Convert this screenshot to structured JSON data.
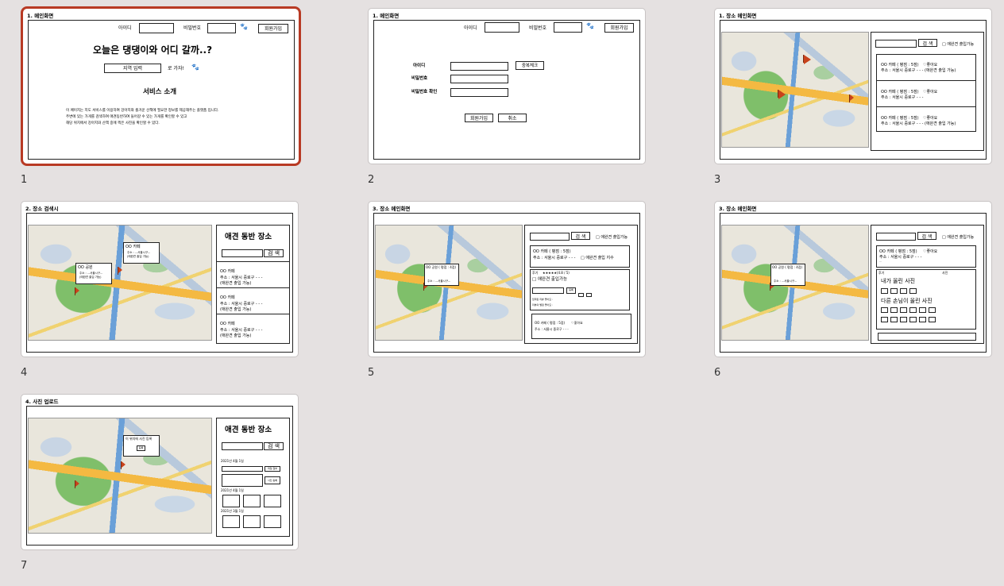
{
  "slides": [
    {
      "num": "1",
      "title": "1. 메인화면",
      "id_label": "아이디",
      "pw_label": "비밀번호",
      "signup": "회원가입",
      "headline": "오늘은 댕댕이와 어디 갈까..?",
      "region_input": "지역 입력",
      "go_label": "로 가자!",
      "about_title": "서비스 소개",
      "about_lines": [
        "이 페이지는 지도 서비스를 이용하여 강아지와 즐거운 산책에 필요한 정보를 제공해주는 플랫폼 입니다.",
        "주변에 있는 가게를 검색하여 애견동반하여 들어갈 수 있는 가게를 확인할 수 있고",
        "해당 위치에서 강아지와 산책 중에 찍은 사진을 확인할 수 있다."
      ]
    },
    {
      "num": "2",
      "title": "1. 메인화면",
      "id_label": "아이디",
      "pw_label": "비밀번호",
      "signup": "회원가입",
      "form_id": "아이디",
      "form_pw": "비밀번호",
      "form_pw2": "비밀번호 확인",
      "dup_check": "중복체크",
      "submit": "회원가입",
      "cancel": "취소"
    },
    {
      "num": "3",
      "title": "1. 장소 메인화면",
      "search": "검 색",
      "pet_ok": "□ 애완견 출입가능",
      "items": [
        {
          "name": "OO 카페 ( 평점 : 5점)",
          "like": "♡좋아요",
          "addr": "주소 : 서울시 중로구 - - -",
          "note": "(애완견 출입 가능)"
        },
        {
          "name": "OO 카페 ( 평점 : 5점)",
          "like": "♡좋아요",
          "addr": "주소 : 서울시 중로구 - - -",
          "note": ""
        },
        {
          "name": "OO 카페 ( 평점 : 5점)",
          "like": "♡좋아요",
          "addr": "주소 : 서울시 중로구 - - -",
          "note": "(애완견 출입 가능)"
        }
      ]
    },
    {
      "num": "4",
      "title": "2. 장소 검색시",
      "panel_title": "애견 동반 장소",
      "search": "검 색",
      "popup1": "OO 카페",
      "popup1_sub": "주소 : ...서울시구...",
      "popup1_note": "(애완견 출입 가능)",
      "popup2": "OO 공원",
      "popup2_sub": "주소 : ...서울시구...",
      "popup2_note": "(애완견 출입 가능)",
      "items": [
        {
          "name": "OO 카페",
          "addr": "주소 : 서울시 중로구 - - -",
          "note": "(애완견 출입 가능)"
        },
        {
          "name": "OO 카페",
          "addr": "주소 : 서울시 중로구 - - -",
          "note": "(애완견 출입 가능)"
        },
        {
          "name": "OO 카페",
          "addr": "주소 : 서울시 중로구 - - -",
          "note": "(애완견 출입 가능)"
        }
      ]
    },
    {
      "num": "5",
      "title": "3. 장소 메인화면",
      "search": "검 색",
      "pet_ok": "□ 애완견 출입가능",
      "popup": "OO 공원 ( 평점 : 4점)",
      "popup_sub": "주소 : ...서울시구...",
      "item_name": "OO 카페 ( 평점 : 5점)",
      "item_addr": "주소 : 서울시 중로구 - - -",
      "item_check": "□ 애완견 출입 지수",
      "review_label": "후기",
      "stars": "★★★★★(4.8 / 5)",
      "pet_check": "□ 애완견 출입가능",
      "review_btn": "등록",
      "review_row1": "입력된 리뷰 좋아요 :",
      "review_row2": "리뷰의 별점 좋아요 :",
      "item2_name": "OO 카페 ( 평점 : 5점)",
      "item2_like": "♡좋아요",
      "item2_addr": "주소 : 서울시 중로구 - - -"
    },
    {
      "num": "6",
      "title": "3. 장소 메인화면",
      "search": "검 색",
      "pet_ok": "□ 애완견 출입가능",
      "popup": "OO 공원 ( 평점 : 4점)",
      "popup_sub": "주소 : ...서울시구...",
      "item_name": "OO 카페 ( 평점 : 5점)",
      "item_like": "♡좋아요",
      "item_addr": "주소 : 서울시 중로구 - - -",
      "item_note": "...",
      "review_label": "후기",
      "photo_label": "사진",
      "my_photos": "내가 올린 사진",
      "others_photos": "다른 손님이 올린 사진"
    },
    {
      "num": "7",
      "title": "4. 사진 업로드",
      "panel_title": "애견 동반 장소",
      "search": "검 색",
      "popup": "이 위치에 사진 등록",
      "popup_btn": "등록",
      "date1": "2021년 4월 1일",
      "date2": "2021년 4월 1일",
      "date3": "2021년 3월 1일",
      "upload_btn": "파일 첨부",
      "photo_btn": "사진 등록"
    }
  ]
}
